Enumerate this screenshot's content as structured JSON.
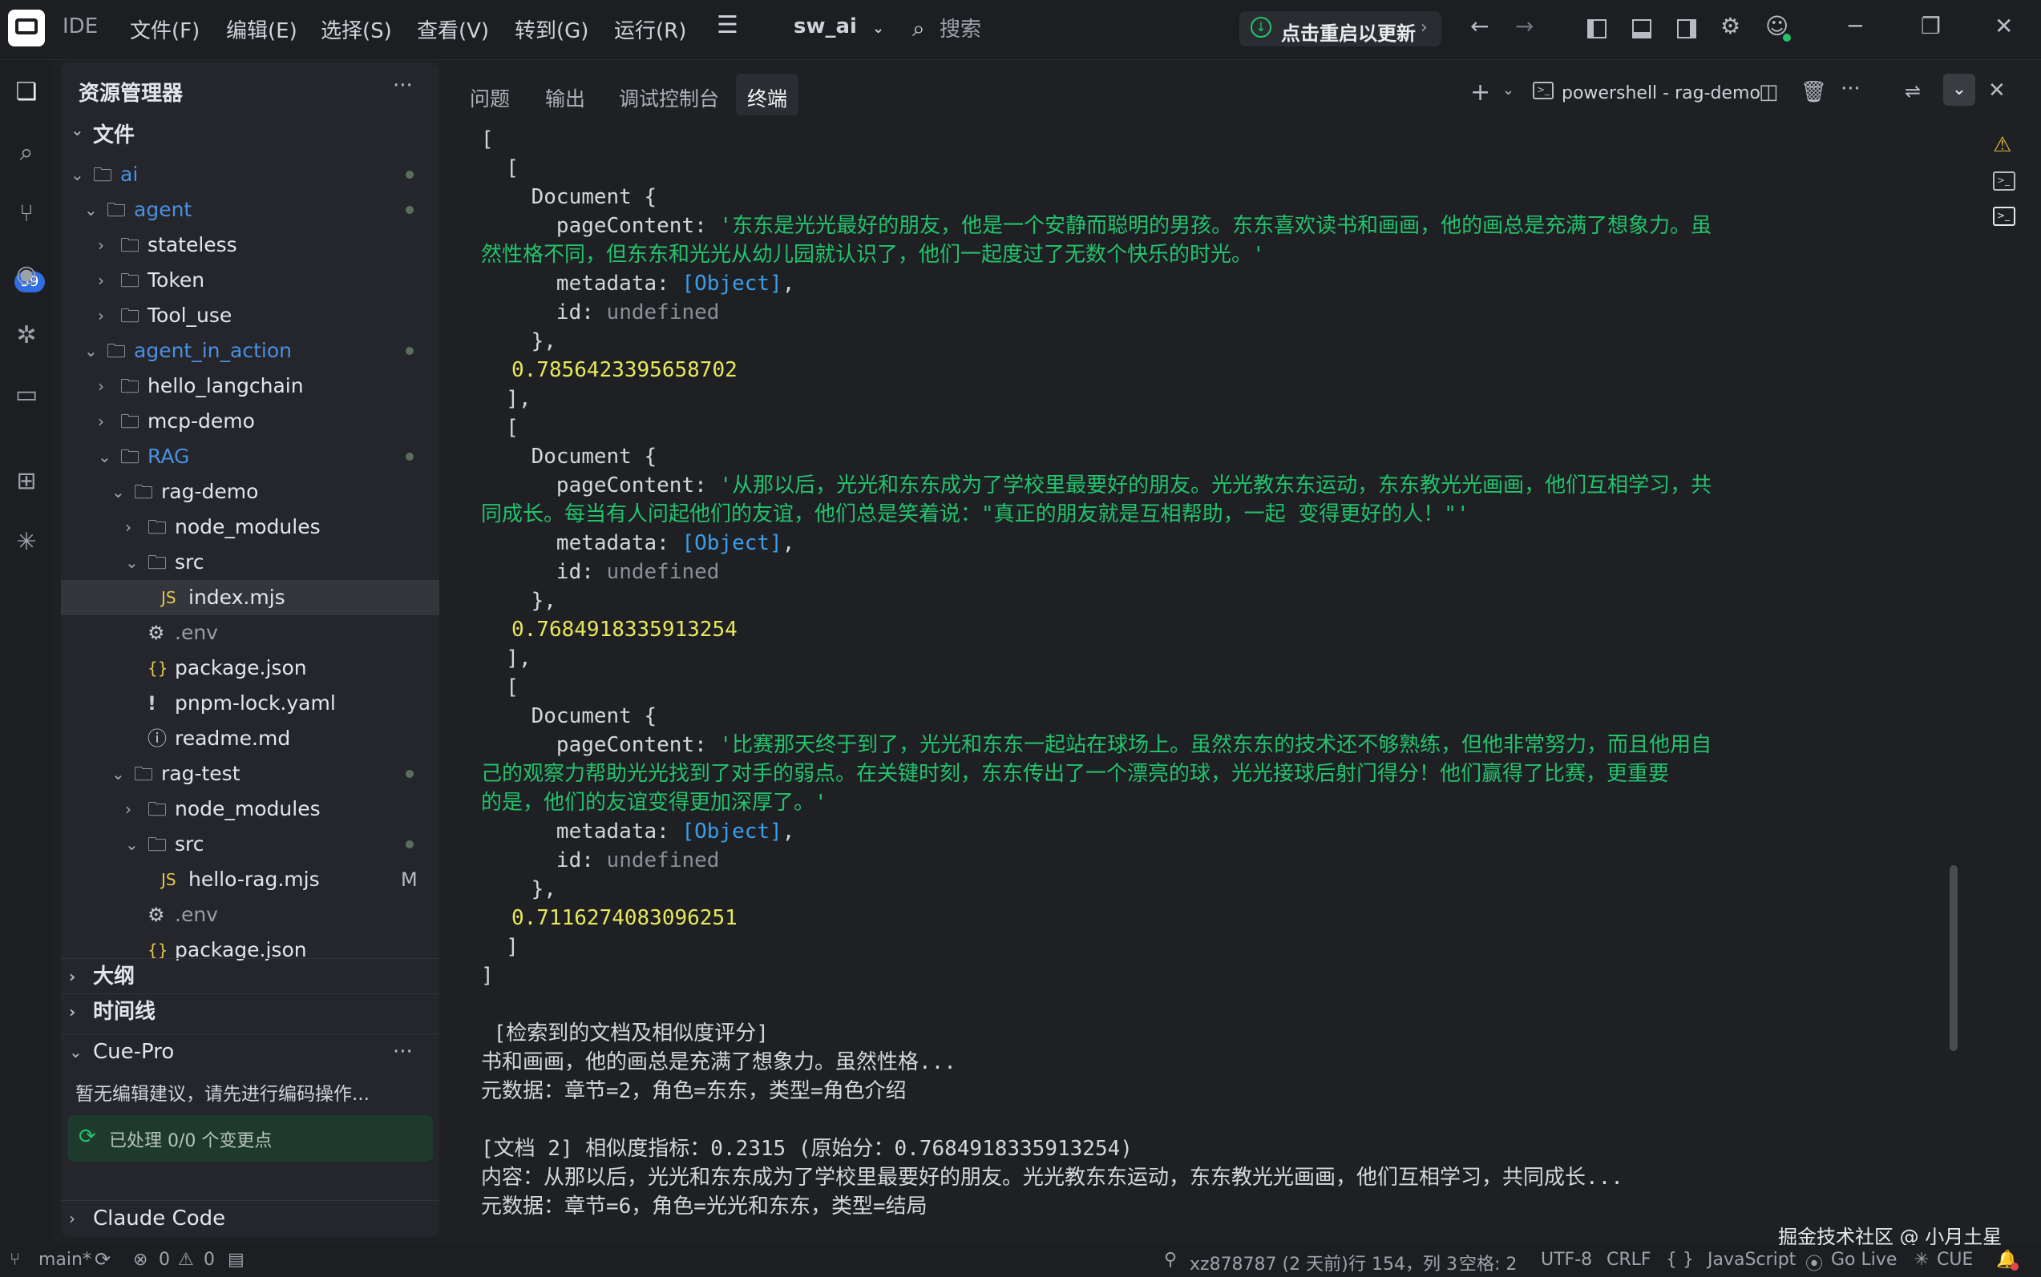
{
  "titlebar": {
    "ide_label": "IDE",
    "menu": [
      "文件(F)",
      "编辑(E)",
      "选择(S)",
      "查看(V)",
      "转到(G)",
      "运行(R)"
    ],
    "project": "sw_ai",
    "search_placeholder": "搜索",
    "update_button": "点击重启以更新"
  },
  "activity": {
    "scm_badge": "59"
  },
  "sidebar": {
    "title": "资源管理器",
    "root": "文件",
    "tree": [
      {
        "label": "ai",
        "depth": 0,
        "type": "folder",
        "open": true,
        "color": "#4a8fe0",
        "dot": true
      },
      {
        "label": "agent",
        "depth": 1,
        "type": "folder",
        "open": true,
        "color": "#4a8fe0",
        "dot": true
      },
      {
        "label": "stateless",
        "depth": 2,
        "type": "folder",
        "open": false
      },
      {
        "label": "Token",
        "depth": 2,
        "type": "folder",
        "open": false
      },
      {
        "label": "Tool_use",
        "depth": 2,
        "type": "folder",
        "open": false
      },
      {
        "label": "agent_in_action",
        "depth": 1,
        "type": "folder",
        "open": true,
        "color": "#4a8fe0",
        "dot": true
      },
      {
        "label": "hello_langchain",
        "depth": 2,
        "type": "folder",
        "open": false
      },
      {
        "label": "mcp-demo",
        "depth": 2,
        "type": "folder",
        "open": false
      },
      {
        "label": "RAG",
        "depth": 2,
        "type": "folder",
        "open": true,
        "color": "#4a8fe0",
        "dot": true
      },
      {
        "label": "rag-demo",
        "depth": 3,
        "type": "folder",
        "open": true
      },
      {
        "label": "node_modules",
        "depth": 4,
        "type": "folder",
        "open": false
      },
      {
        "label": "src",
        "depth": 4,
        "type": "folder",
        "open": true
      },
      {
        "label": "index.mjs",
        "depth": 5,
        "type": "js",
        "selected": true
      },
      {
        "label": ".env",
        "depth": 4,
        "type": "gear",
        "color": "#9a9da4"
      },
      {
        "label": "package.json",
        "depth": 4,
        "type": "json"
      },
      {
        "label": "pnpm-lock.yaml",
        "depth": 4,
        "type": "yaml"
      },
      {
        "label": "readme.md",
        "depth": 4,
        "type": "info"
      },
      {
        "label": "rag-test",
        "depth": 3,
        "type": "folder",
        "open": true,
        "dot": true
      },
      {
        "label": "node_modules",
        "depth": 4,
        "type": "folder",
        "open": false
      },
      {
        "label": "src",
        "depth": 4,
        "type": "folder",
        "open": true,
        "dot": true
      },
      {
        "label": "hello-rag.mjs",
        "depth": 5,
        "type": "js",
        "mark": "M"
      },
      {
        "label": ".env",
        "depth": 4,
        "type": "gear",
        "color": "#9a9da4"
      },
      {
        "label": "package.json",
        "depth": 4,
        "type": "json"
      }
    ],
    "sections": [
      "大纲",
      "时间线"
    ],
    "cue": {
      "title": "Cue-Pro",
      "hint": "暂无编辑建议，请先进行编码操作...",
      "processed": "已处理 0/0 个变更点"
    },
    "claude": "Claude Code"
  },
  "panel": {
    "tabs": [
      "问题",
      "输出",
      "调试控制台",
      "终端"
    ],
    "active_tab": "终端",
    "terminal_name": "powershell - rag-demo"
  },
  "terminal": {
    "open_outer": "[",
    "open_inner": "  [",
    "close_inner": "  ],",
    "close_inner_last": "  ]",
    "close_outer": "]",
    "doc_open": "    Document {",
    "doc_close": "    },",
    "pc_key": "      pageContent: ",
    "md_key": "      metadata: ",
    "id_key": "      id: ",
    "md_val": "[Object]",
    "id_val": "undefined",
    "docs": [
      {
        "l1": "'东东是光光最好的朋友，他是一个安静而聪明的男孩。东东喜欢读书和画画，他的画总是充满了想象力。虽",
        "l2": "然性格不同，但东东和光光从幼儿园就认识了，他们一起度过了无数个快乐的时光。'",
        "l3": "",
        "score": "0.7856423395658702"
      },
      {
        "l1": "'从那以后，光光和东东成为了学校里最要好的朋友。光光教东东运动，东东教光光画画，他们互相学习，共",
        "l2": "同成长。每当有人问起他们的友谊，他们总是笑着说：\"真正的朋友就是互相帮助，一起 变得更好的人！\"'",
        "l3": "",
        "score": "0.7684918335913254"
      },
      {
        "l1": "'比赛那天终于到了，光光和东东一起站在球场上。虽然东东的技术还不够熟练，但他非常努力，而且他用自",
        "l2": "己的观察力帮助光光找到了对手的弱点。在关键时刻，东东传出了一个漂亮的球，光光接球后射门得分！他们赢得了比赛，更重要",
        "l3": "的是，他们的友谊变得更加深厚了。'",
        "score": "0.7116274083096251"
      }
    ],
    "summary": {
      "header": " [检索到的文档及相似度评分]",
      "line1": "书和画画，他的画总是充满了想象力。虽然性格...",
      "line2": "元数据：章节=2，角色=东东，类型=角色介绍",
      "line3": "[文档 2] 相似度指标：0.2315 (原始分：0.7684918335913254)",
      "line4": "内容：从那以后，光光和东东成为了学校里最要好的朋友。光光教东东运动，东东教光光画画，他们互相学习，共同成长...",
      "line5": "元数据：章节=6，角色=光光和东东，类型=结局"
    }
  },
  "statusbar": {
    "branch": "main*",
    "errors": "0",
    "warnings": "0",
    "commit": "xz878787 (2 天前)",
    "position": "行 154，列 3",
    "spaces": "空格: 2",
    "encoding": "UTF-8",
    "eol": "CRLF",
    "braces": "{ }",
    "language": "JavaScript",
    "golive": "Go Live",
    "cue": "CUE"
  },
  "watermark": "掘金技术社区 @ 小月土星",
  "colors": {
    "string": "#23c26b",
    "number": "#e8e85a",
    "object": "#3b9ee8",
    "accent": "#2f6de1"
  }
}
